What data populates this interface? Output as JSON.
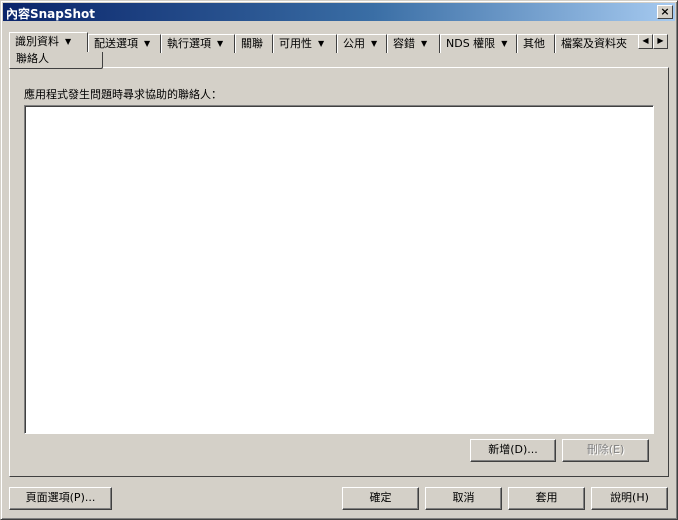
{
  "window": {
    "title": "內容SnapShot",
    "close_label": "×"
  },
  "tabs": [
    {
      "label": "識別資料",
      "has_menu": true
    },
    {
      "label": "配送選項",
      "has_menu": true
    },
    {
      "label": "執行選項",
      "has_menu": true
    },
    {
      "label": "關聯",
      "has_menu": false
    },
    {
      "label": "可用性",
      "has_menu": true
    },
    {
      "label": "公用",
      "has_menu": true
    },
    {
      "label": "容錯",
      "has_menu": true
    },
    {
      "label": "NDS 權限",
      "has_menu": true
    },
    {
      "label": "其他",
      "has_menu": false
    },
    {
      "label": "檔案及資料夾",
      "has_menu": false
    }
  ],
  "active_subtab": "聯絡人",
  "tab_scroll": {
    "left": "◀",
    "right": "▶"
  },
  "tab_menu_arrow": "▼",
  "panel": {
    "label": "應用程式發生問題時尋求協助的聯絡人：",
    "add_button": "新增(D)...",
    "delete_button": "刪除(E)"
  },
  "footer": {
    "page_options": "頁面選項(P)...",
    "ok": "確定",
    "cancel": "取消",
    "apply": "套用",
    "help": "說明(H)"
  }
}
